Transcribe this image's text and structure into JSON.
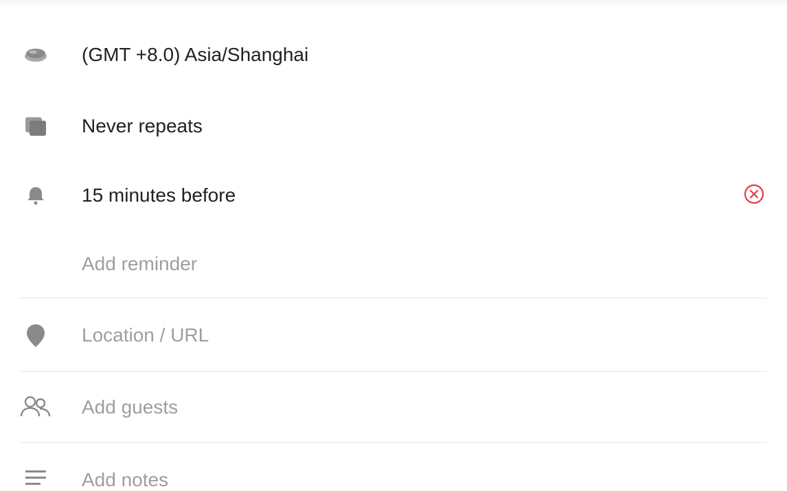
{
  "rows": {
    "timezone": {
      "label": "(GMT +8.0) Asia/Shanghai",
      "icon": "globe-icon"
    },
    "repeat": {
      "label": "Never repeats",
      "icon": "repeat-icon"
    },
    "reminder": {
      "label": "15 minutes before",
      "icon": "bell-icon",
      "clear_icon": "close-circle-icon"
    },
    "add_reminder": {
      "label": "Add reminder"
    },
    "location": {
      "placeholder": "Location / URL",
      "icon": "location-pin-icon"
    },
    "guests": {
      "placeholder": "Add guests",
      "icon": "people-icon"
    },
    "notes": {
      "placeholder": "Add notes",
      "icon": "notes-icon"
    }
  },
  "colors": {
    "icon_gray": "#8a8a8a",
    "text_primary": "#202124",
    "text_hint": "#9e9e9e",
    "clear_red": "#e53950",
    "divider": "#e6e6e6"
  }
}
